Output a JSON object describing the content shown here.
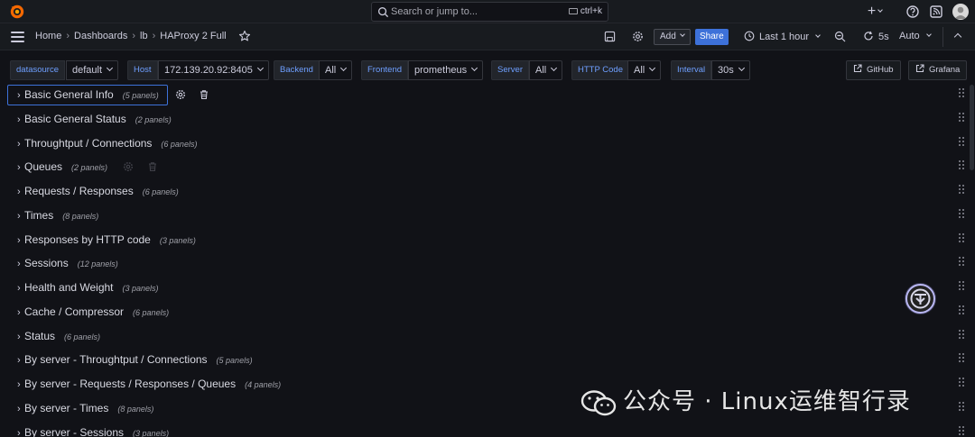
{
  "topbar": {
    "search_placeholder": "Search or jump to...",
    "search_shortcut": "ctrl+k",
    "plus_label": "+"
  },
  "nav": {
    "breadcrumbs": [
      "Home",
      "Dashboards",
      "lb",
      "HAProxy 2 Full"
    ],
    "add_label": "Add",
    "share_label": "Share",
    "time_range": "Last 1 hour",
    "refresh_interval": "5s",
    "auto_label": "Auto"
  },
  "variables": [
    {
      "label": "datasource",
      "value": "default"
    },
    {
      "label": "Host",
      "value": "172.139.20.92:8405"
    },
    {
      "label": "Backend",
      "value": "All"
    },
    {
      "label": "Frontend",
      "value": "prometheus"
    },
    {
      "label": "Server",
      "value": "All"
    },
    {
      "label": "HTTP Code",
      "value": "All"
    },
    {
      "label": "Interval",
      "value": "30s"
    }
  ],
  "links": {
    "github": "GitHub",
    "grafana": "Grafana"
  },
  "rows": [
    {
      "title": "Basic General Info",
      "count": "(5 panels)"
    },
    {
      "title": "Basic General Status",
      "count": "(2 panels)"
    },
    {
      "title": "Throughtput / Connections",
      "count": "(6 panels)"
    },
    {
      "title": "Queues",
      "count": "(2 panels)"
    },
    {
      "title": "Requests / Responses",
      "count": "(6 panels)"
    },
    {
      "title": "Times",
      "count": "(8 panels)"
    },
    {
      "title": "Responses by HTTP code",
      "count": "(3 panels)"
    },
    {
      "title": "Sessions",
      "count": "(12 panels)"
    },
    {
      "title": "Health and Weight",
      "count": "(3 panels)"
    },
    {
      "title": "Cache / Compressor",
      "count": "(6 panels)"
    },
    {
      "title": "Status",
      "count": "(6 panels)"
    },
    {
      "title": "By server - Throughtput / Connections",
      "count": "(5 panels)"
    },
    {
      "title": "By server - Requests / Responses / Queues",
      "count": "(4 panels)"
    },
    {
      "title": "By server - Times",
      "count": "(8 panels)"
    },
    {
      "title": "By server - Sessions",
      "count": "(3 panels)"
    }
  ],
  "watermark": "公众号 · Linux运维智行录",
  "colors": {
    "accent": "#3d71d9",
    "variable_label": "#6e9fff",
    "background": "#111217"
  }
}
